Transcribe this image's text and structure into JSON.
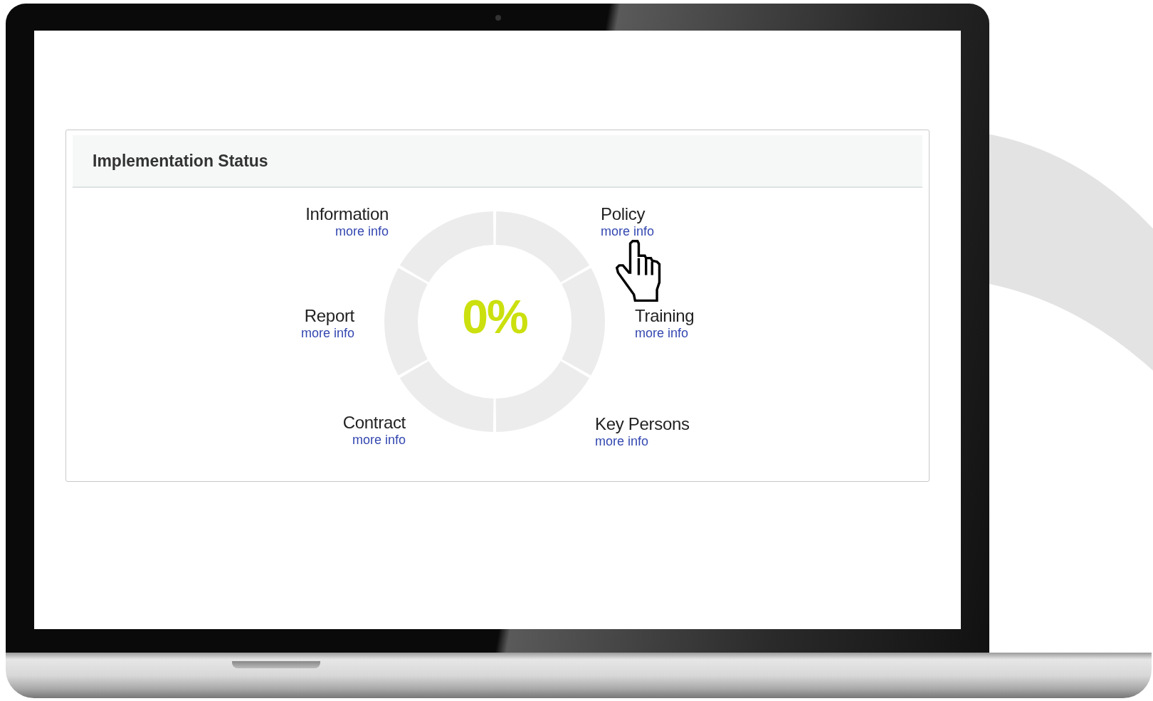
{
  "panel": {
    "title": "Implementation Status",
    "center_value": "0%",
    "areas": [
      {
        "label": "Information",
        "link": "more info"
      },
      {
        "label": "Policy",
        "link": "more info"
      },
      {
        "label": "Report",
        "link": "more info"
      },
      {
        "label": "Training",
        "link": "more info"
      },
      {
        "label": "Contract",
        "link": "more info"
      },
      {
        "label": "Key Persons",
        "link": "more info"
      }
    ]
  }
}
